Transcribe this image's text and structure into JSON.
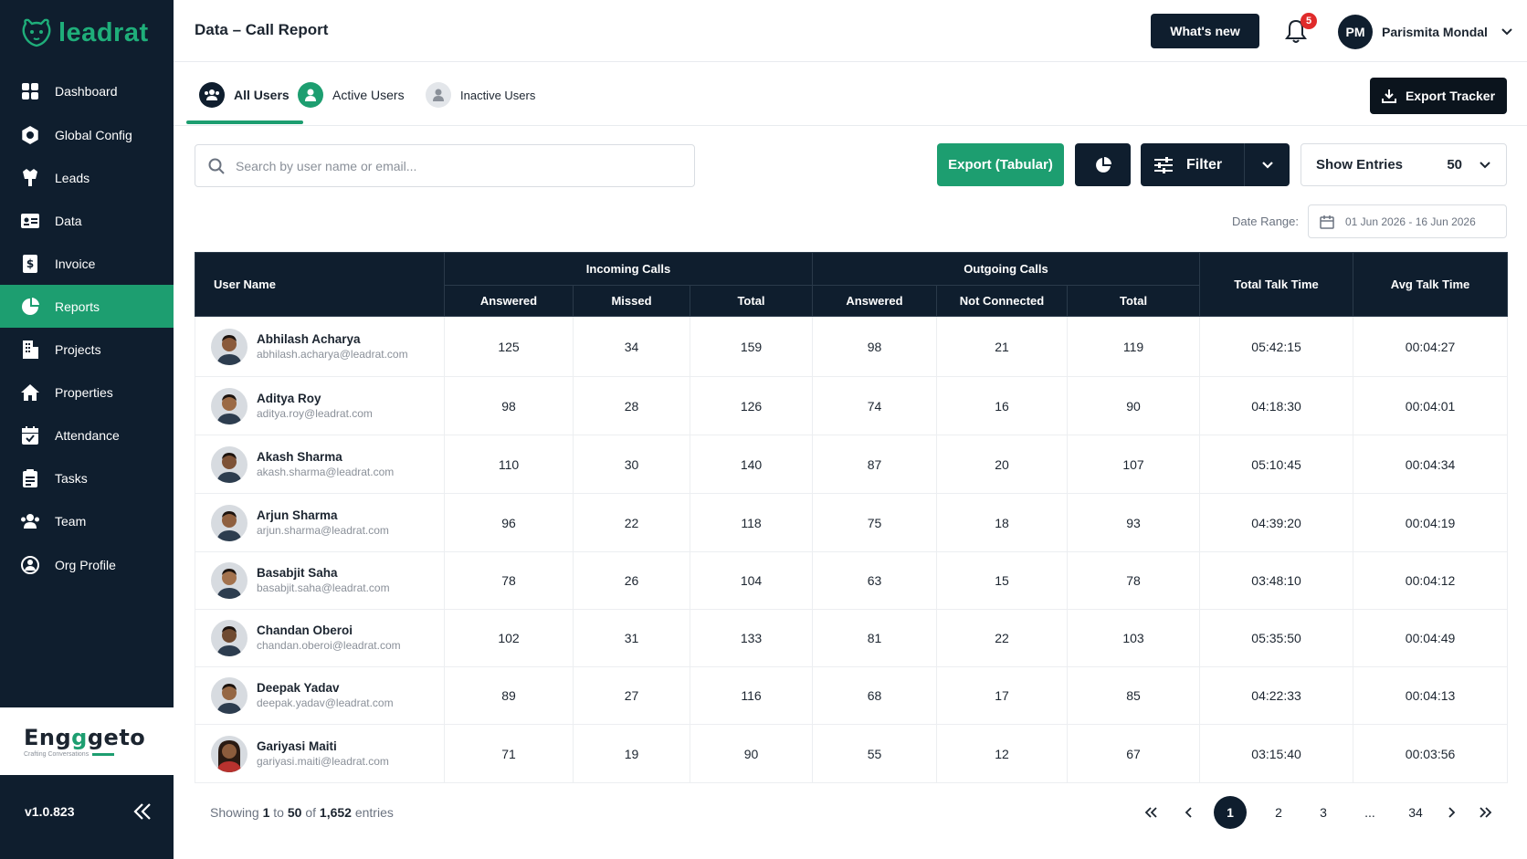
{
  "brand": {
    "name": "leadrat",
    "accent": "#1d9e70",
    "sidebar_bg": "#0f1e2e"
  },
  "sidebar": {
    "items": [
      {
        "label": "Dashboard",
        "icon": "grid-icon",
        "active": false
      },
      {
        "label": "Global Config",
        "icon": "settings-icon",
        "active": false
      },
      {
        "label": "Leads",
        "icon": "leads-icon",
        "active": false
      },
      {
        "label": "Data",
        "icon": "id-card-icon",
        "active": false
      },
      {
        "label": "Invoice",
        "icon": "invoice-icon",
        "active": false
      },
      {
        "label": "Reports",
        "icon": "pie-chart-icon",
        "active": true
      },
      {
        "label": "Projects",
        "icon": "building-icon",
        "active": false
      },
      {
        "label": "Properties",
        "icon": "home-icon",
        "active": false
      },
      {
        "label": "Attendance",
        "icon": "calendar-icon",
        "active": false
      },
      {
        "label": "Tasks",
        "icon": "clipboard-icon",
        "active": false
      },
      {
        "label": "Team",
        "icon": "team-icon",
        "active": false
      },
      {
        "label": "Org Profile",
        "icon": "org-icon",
        "active": false
      }
    ],
    "partner": {
      "name_a": "Eng",
      "name_b": "g",
      "name_c": "geto",
      "tagline": "Crafting Conversations"
    },
    "version": "v1.0.823"
  },
  "header": {
    "title": "Data – Call Report",
    "whats_new": "What's new",
    "notification_count": "5",
    "user_initials": "PM",
    "user_name": "Parismita Mondal"
  },
  "tabs": {
    "items": [
      {
        "label": "All Users",
        "active": true
      },
      {
        "label": "Active Users",
        "active": false
      },
      {
        "label": "Inactive Users",
        "active": false
      }
    ],
    "export_tracker": "Export Tracker"
  },
  "toolbar": {
    "search_placeholder": "Search by user name or email...",
    "export_tabular": "Export (Tabular)",
    "filter": "Filter",
    "show_entries_label": "Show Entries",
    "show_entries_value": "50",
    "date_range_label": "Date Range:",
    "date_range_value": "01 Jun 2026 - 16 Jun 2026"
  },
  "table": {
    "headers": {
      "user_name": "User Name",
      "incoming": "Incoming Calls",
      "outgoing": "Outgoing Calls",
      "total_talk": "Total Talk Time",
      "avg_talk": "Avg Talk Time",
      "in_answered": "Answered",
      "in_missed": "Missed",
      "in_total": "Total",
      "out_answered": "Answered",
      "out_not_connected": "Not Connected",
      "out_total": "Total"
    },
    "rows": [
      {
        "name": "Abhilash Acharya",
        "email": "abhilash.acharya@leadrat.com",
        "in_answered": "125",
        "in_missed": "34",
        "in_total": "159",
        "out_answered": "98",
        "out_not_connected": "21",
        "out_total": "119",
        "total_talk": "05:42:15",
        "avg_talk": "00:04:27"
      },
      {
        "name": "Aditya Roy",
        "email": "aditya.roy@leadrat.com",
        "in_answered": "98",
        "in_missed": "28",
        "in_total": "126",
        "out_answered": "74",
        "out_not_connected": "16",
        "out_total": "90",
        "total_talk": "04:18:30",
        "avg_talk": "00:04:01"
      },
      {
        "name": "Akash Sharma",
        "email": "akash.sharma@leadrat.com",
        "in_answered": "110",
        "in_missed": "30",
        "in_total": "140",
        "out_answered": "87",
        "out_not_connected": "20",
        "out_total": "107",
        "total_talk": "05:10:45",
        "avg_talk": "00:04:34"
      },
      {
        "name": "Arjun Sharma",
        "email": "arjun.sharma@leadrat.com",
        "in_answered": "96",
        "in_missed": "22",
        "in_total": "118",
        "out_answered": "75",
        "out_not_connected": "18",
        "out_total": "93",
        "total_talk": "04:39:20",
        "avg_talk": "00:04:19"
      },
      {
        "name": "Basabjit Saha",
        "email": "basabjit.saha@leadrat.com",
        "in_answered": "78",
        "in_missed": "26",
        "in_total": "104",
        "out_answered": "63",
        "out_not_connected": "15",
        "out_total": "78",
        "total_talk": "03:48:10",
        "avg_talk": "00:04:12"
      },
      {
        "name": "Chandan Oberoi",
        "email": "chandan.oberoi@leadrat.com",
        "in_answered": "102",
        "in_missed": "31",
        "in_total": "133",
        "out_answered": "81",
        "out_not_connected": "22",
        "out_total": "103",
        "total_talk": "05:35:50",
        "avg_talk": "00:04:49"
      },
      {
        "name": "Deepak Yadav",
        "email": "deepak.yadav@leadrat.com",
        "in_answered": "89",
        "in_missed": "27",
        "in_total": "116",
        "out_answered": "68",
        "out_not_connected": "17",
        "out_total": "85",
        "total_talk": "04:22:33",
        "avg_talk": "00:04:13"
      },
      {
        "name": "Gariyasi Maiti",
        "email": "gariyasi.maiti@leadrat.com",
        "in_answered": "71",
        "in_missed": "19",
        "in_total": "90",
        "out_answered": "55",
        "out_not_connected": "12",
        "out_total": "67",
        "total_talk": "03:15:40",
        "avg_talk": "00:03:56"
      }
    ]
  },
  "footer": {
    "showing_prefix": "Showing",
    "showing_from": "1",
    "showing_to_word": "to",
    "showing_to": "50",
    "showing_of_word": "of",
    "showing_total": "1,652",
    "showing_suffix": "entries",
    "pages": [
      "1",
      "2",
      "3",
      "...",
      "34"
    ],
    "current_page": "1"
  }
}
